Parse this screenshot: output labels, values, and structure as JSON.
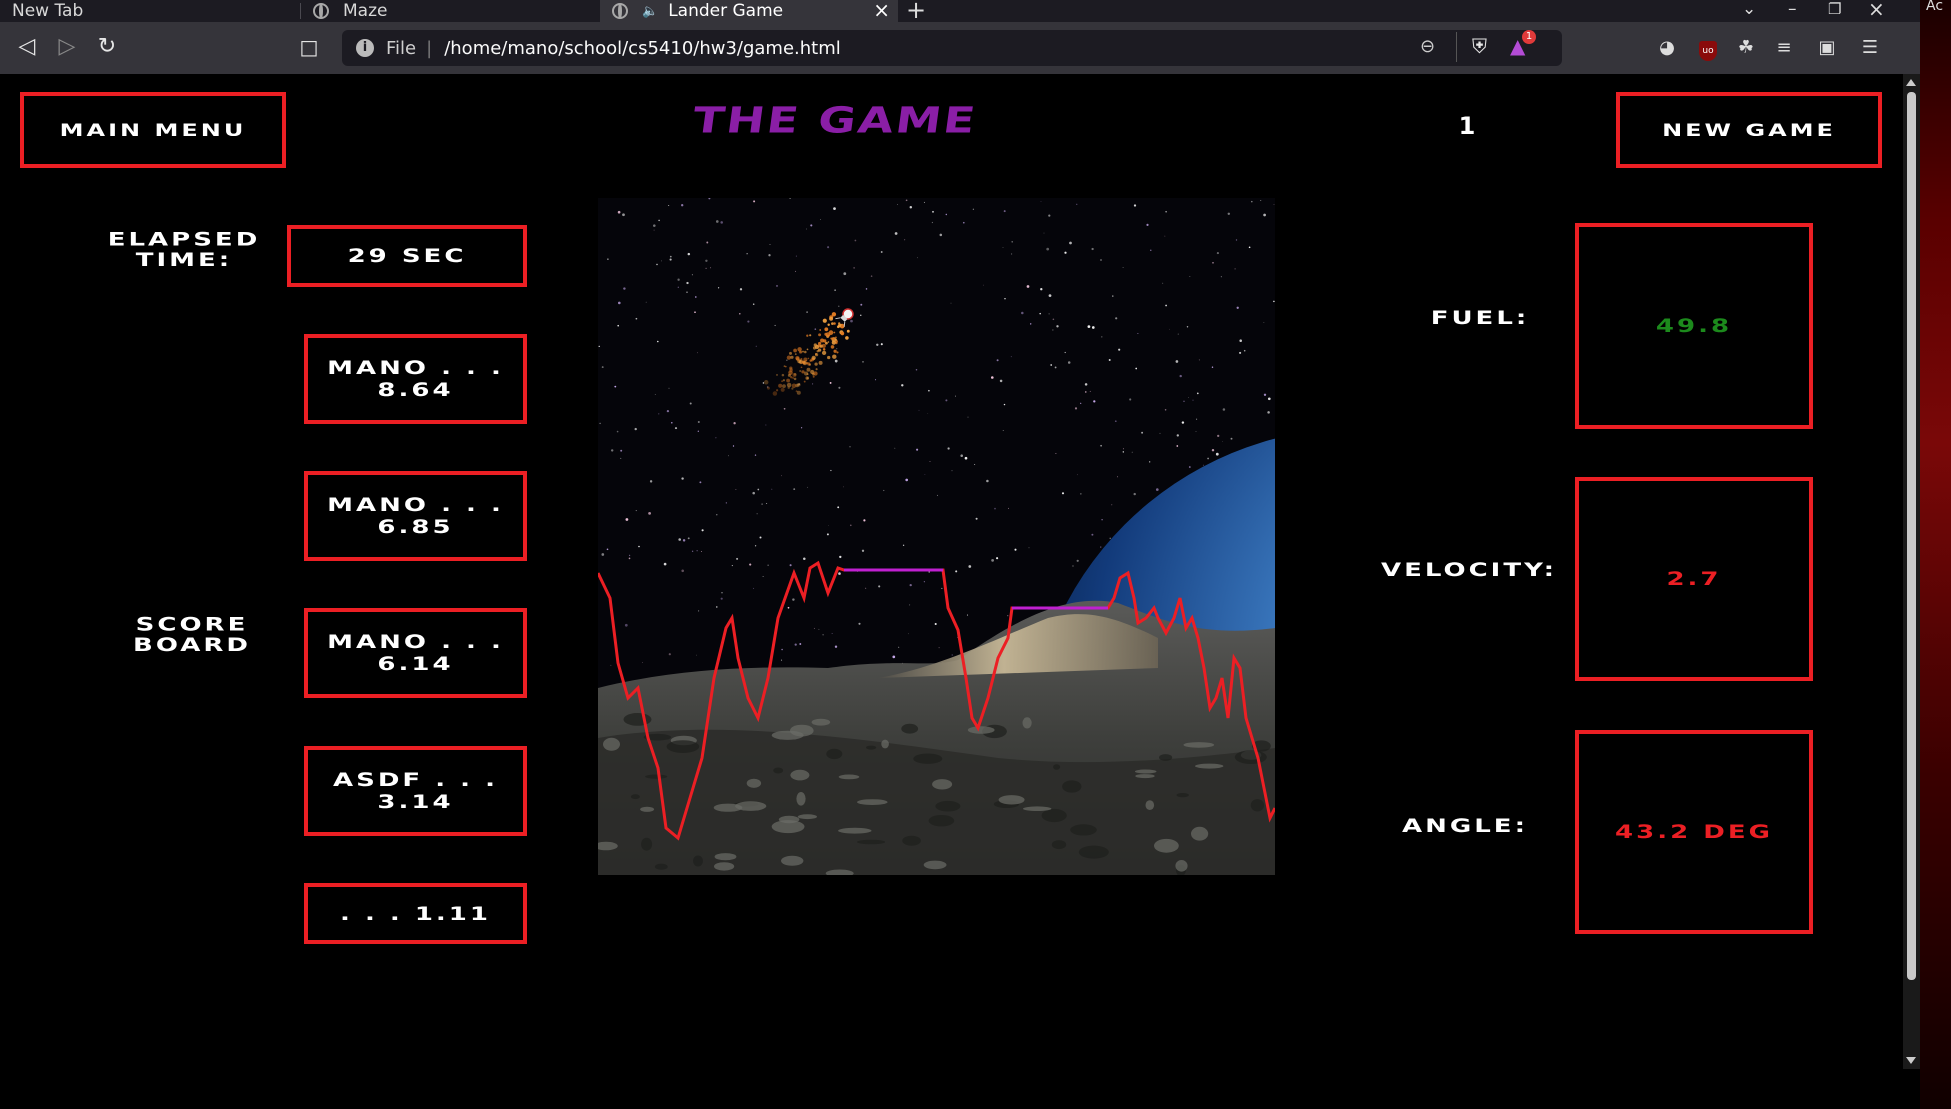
{
  "browser": {
    "tabs": [
      {
        "label": "New Tab"
      },
      {
        "label": "Maze"
      },
      {
        "label": "Lander Game"
      }
    ],
    "url_scheme": "File",
    "url": "/home/mano/school/cs5410/hw3/game.html",
    "edge_text": "Ac"
  },
  "game": {
    "title": "THE GAME",
    "main_menu_label": "MAIN MENU",
    "new_game_label": "NEW GAME",
    "level": "1",
    "elapsed_label": "ELAPSED TIME:",
    "elapsed_value": "29 SEC",
    "scoreboard_label": "SCORE BOARD",
    "scores": [
      {
        "line1": "MANO . . .",
        "line2": "8.64"
      },
      {
        "line1": "MANO . . .",
        "line2": "6.85"
      },
      {
        "line1": "MANO . . .",
        "line2": "6.14"
      },
      {
        "line1": "ASDF . . .",
        "line2": "3.14"
      },
      {
        "line1": ". . . 1.11",
        "line2": ""
      }
    ],
    "fuel_label": "FUEL:",
    "fuel_value": "49.8",
    "velocity_label": "VELOCITY:",
    "velocity_value": "2.7",
    "angle_label": "ANGLE:",
    "angle_value": "43.2 DEG",
    "colors": {
      "border": "#ec1f24",
      "title": "#8a1ea6",
      "fuel": "#1c8a1c",
      "warning": "#ec1f24",
      "terrain": "#ec1f24",
      "landing_pad": "#c020d0"
    }
  }
}
